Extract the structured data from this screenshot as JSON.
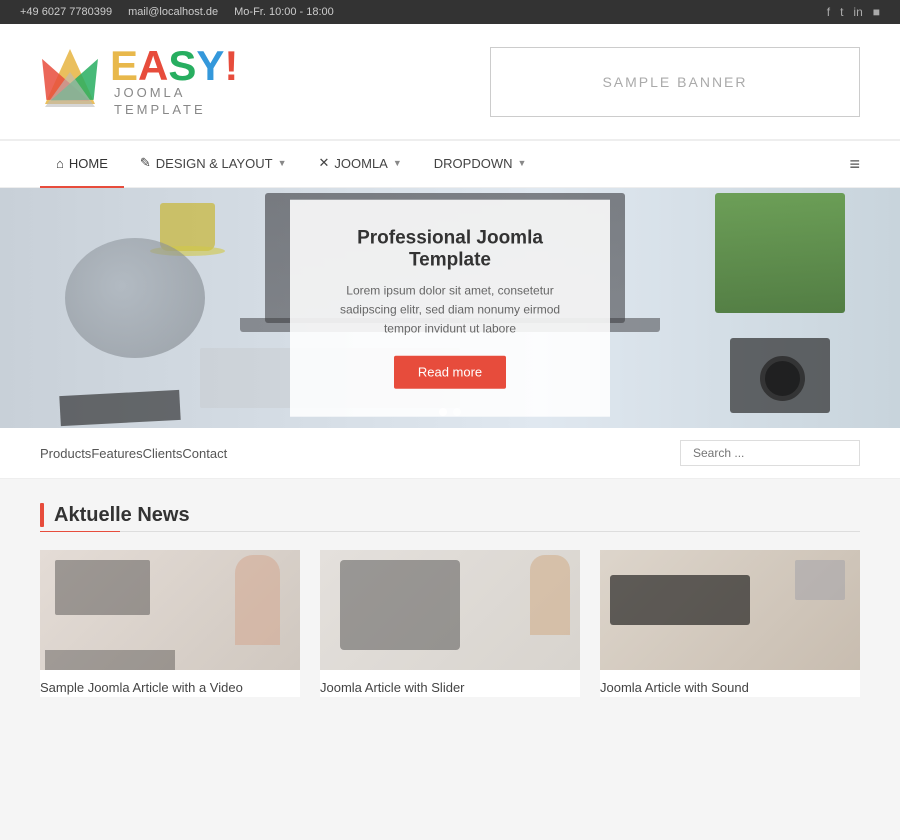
{
  "topbar": {
    "phone": "+49 6027 7780399",
    "email": "mail@localhost.de",
    "hours": "Mo-Fr. 10:00 - 18:00",
    "social": [
      "f",
      "t",
      "in",
      "rss"
    ]
  },
  "header": {
    "logo": {
      "letters": {
        "e": "E",
        "a": "A",
        "s": "S",
        "y": "Y",
        "exclaim": "!"
      },
      "subtitle_line1": "JOOMLA",
      "subtitle_line2": "TEMPLATE"
    },
    "banner_text": "SAMPLE BANNER"
  },
  "nav": {
    "items": [
      {
        "label": "HOME",
        "active": true,
        "icon": "home"
      },
      {
        "label": "DESIGN & LAYOUT",
        "active": false,
        "has_dropdown": true,
        "icon": "brush"
      },
      {
        "label": "JOOMLA",
        "active": false,
        "has_dropdown": true,
        "icon": "x"
      },
      {
        "label": "DROPDOWN",
        "active": false,
        "has_dropdown": true
      }
    ]
  },
  "hero": {
    "slide": {
      "title": "Professional Joomla Template",
      "text": "Lorem ipsum dolor sit amet, consetetur sadipscing elitr, sed diam nonumy eirmod tempor invidunt ut labore",
      "btn_label": "Read more"
    },
    "dots": [
      true,
      false
    ]
  },
  "secondary_nav": {
    "links": [
      "Products",
      "Features",
      "Clients",
      "Contact"
    ],
    "search_placeholder": "Search ..."
  },
  "news": {
    "section_title": "Aktuelle News",
    "articles": [
      {
        "title": "Sample Joomla Article with a Video"
      },
      {
        "title": "Joomla Article with Slider"
      },
      {
        "title": "Joomla Article with Sound"
      }
    ]
  }
}
